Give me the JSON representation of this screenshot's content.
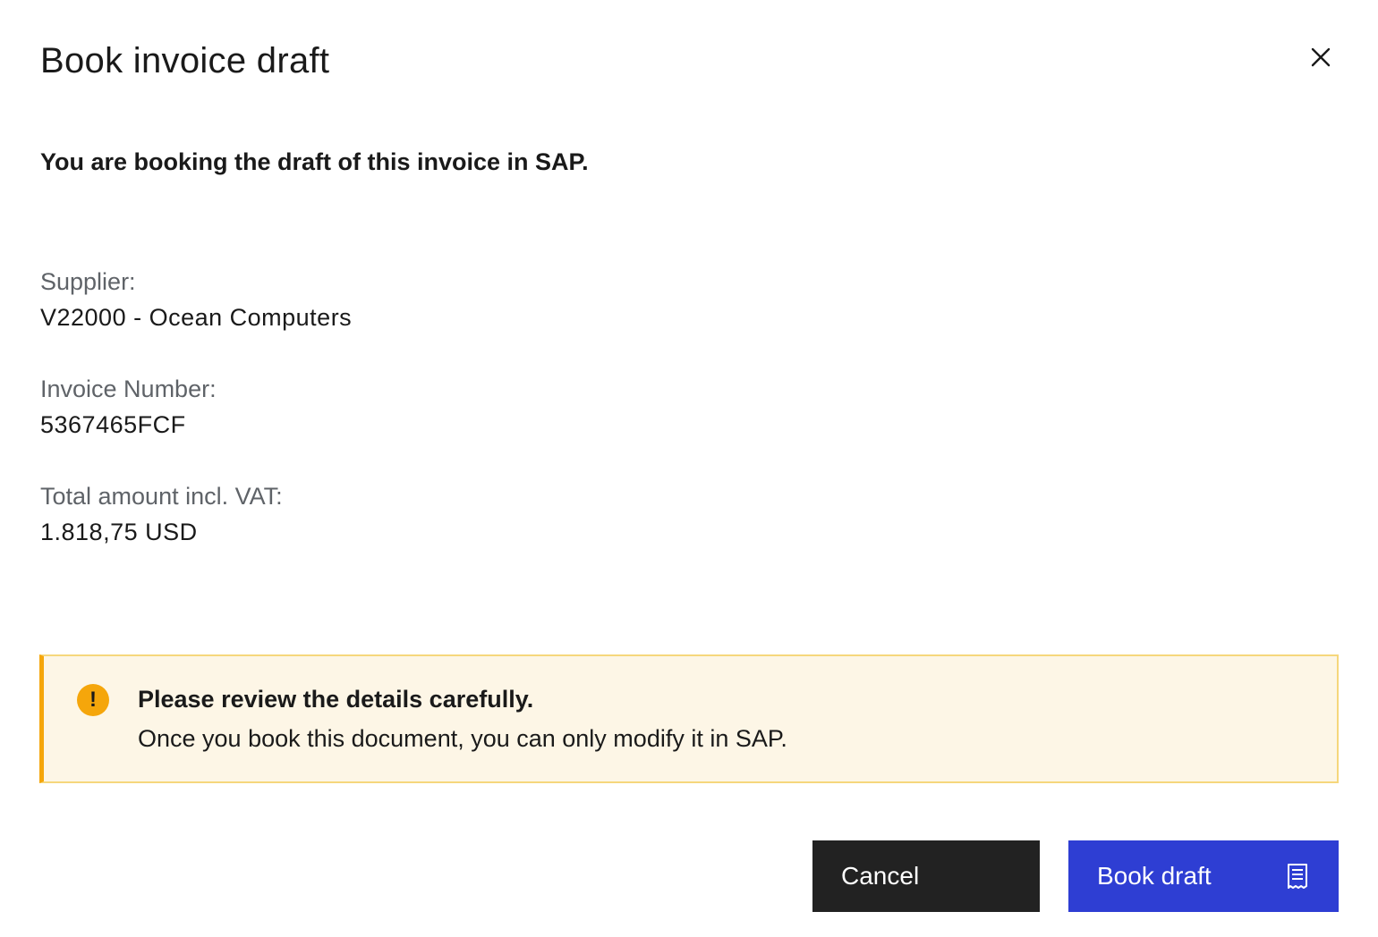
{
  "dialog": {
    "title": "Book invoice draft",
    "close_icon": "close-icon",
    "intro": "You are booking the draft of this invoice in SAP."
  },
  "fields": {
    "supplier_label": "Supplier:",
    "supplier_value": "V22000 - Ocean Computers",
    "invoice_number_label": "Invoice Number:",
    "invoice_number_value": "5367465FCF",
    "total_label": "Total amount incl. VAT:",
    "total_value": "1.818,75 USD"
  },
  "warning": {
    "icon": "exclamation-icon",
    "title": "Please review the details carefully.",
    "text": "Once you book this document, you can only modify it in SAP.",
    "accent_color": "#f5a60b",
    "background_color": "#fdf6e6"
  },
  "actions": {
    "cancel_label": "Cancel",
    "book_label": "Book draft",
    "book_icon": "receipt-icon",
    "cancel_color": "#222222",
    "book_color": "#2e3ed3"
  }
}
